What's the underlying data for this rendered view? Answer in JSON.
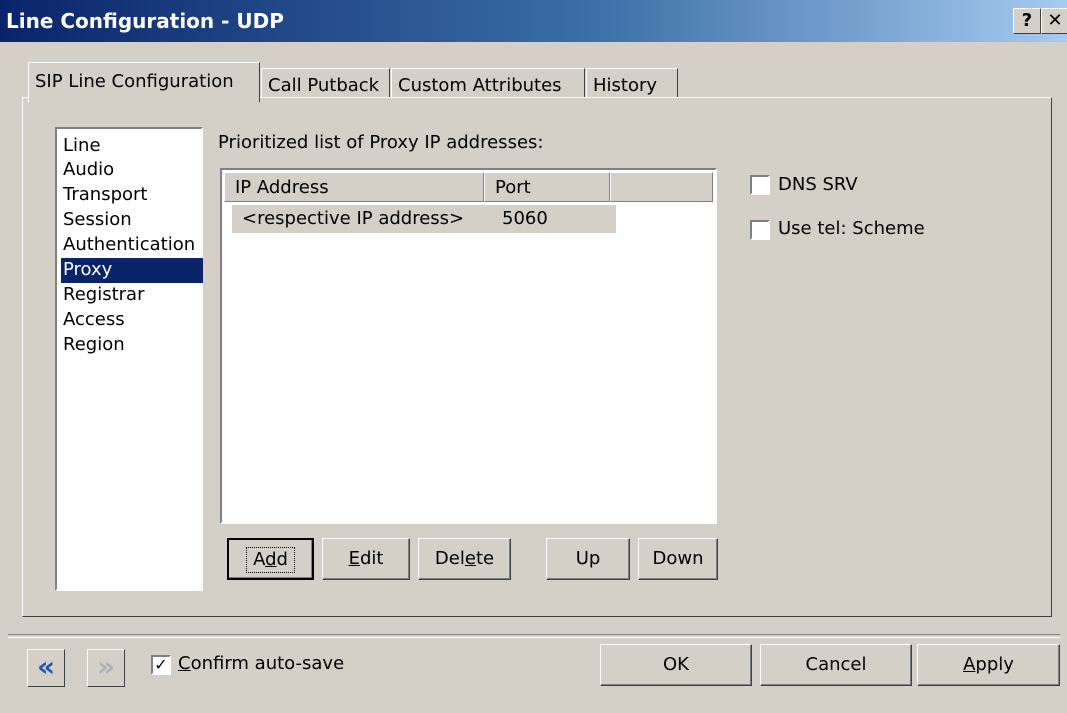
{
  "window": {
    "title": "Line Configuration - UDP",
    "help_label": "?",
    "close_label": "✕"
  },
  "tabs": [
    {
      "label": "SIP Line Configuration"
    },
    {
      "label": "Call Putback"
    },
    {
      "label": "Custom Attributes"
    },
    {
      "label": "History"
    }
  ],
  "nav": {
    "items": [
      "Line",
      "Audio",
      "Transport",
      "Session",
      "Authentication",
      "Proxy",
      "Registrar",
      "Access",
      "Region"
    ],
    "selected": "Proxy"
  },
  "proxy": {
    "list_label": "Prioritized list of Proxy IP addresses:",
    "columns": [
      "IP Address",
      "Port"
    ],
    "rows": [
      {
        "ip": "<respective IP address>",
        "port": "5060"
      }
    ],
    "buttons": {
      "add": {
        "pre": "A",
        "ul": "d",
        "post": "d"
      },
      "edit": {
        "pre": "",
        "ul": "E",
        "post": "dit"
      },
      "delete": {
        "pre": "Del",
        "ul": "e",
        "post": "te"
      },
      "up": "Up",
      "down": "Down"
    },
    "options": {
      "dns_srv": "DNS SRV",
      "use_tel": "Use tel: Scheme"
    }
  },
  "footer": {
    "back_icon": "«",
    "forward_icon": "»",
    "confirm_ul": "C",
    "confirm_rest": "onfirm auto-save",
    "confirm_checked": "✓",
    "ok": "OK",
    "cancel": "Cancel",
    "apply_ul": "A",
    "apply_rest": "pply"
  },
  "colors": {
    "titlebar_start": "#0a246a",
    "titlebar_end": "#a6caf0",
    "selection": "#0a246a",
    "face": "#d4d0c8"
  }
}
